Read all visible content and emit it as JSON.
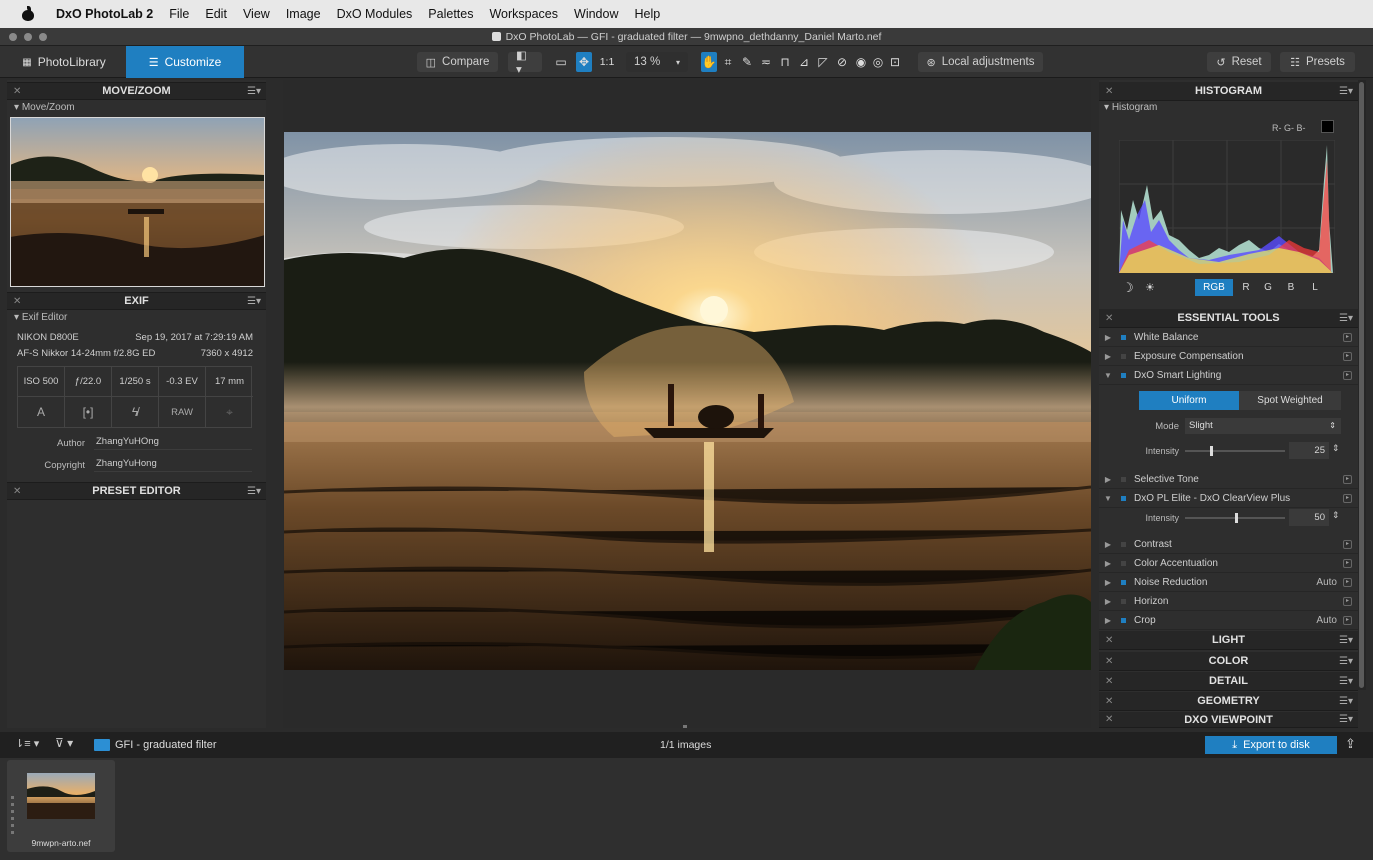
{
  "menubar": {
    "app_name": "DxO PhotoLab 2",
    "items": [
      "File",
      "Edit",
      "View",
      "Image",
      "DxO Modules",
      "Palettes",
      "Workspaces",
      "Window",
      "Help"
    ]
  },
  "titlebar": {
    "title": "DxO PhotoLab — GFI - graduated filter — 9mwpno_dethdanny_Daniel Marto.nef"
  },
  "toolbar": {
    "tab_library": "PhotoLibrary",
    "tab_customize": "Customize",
    "compare_label": "Compare",
    "one_to_one": "1:1",
    "zoom_value": "13 %",
    "local_adjustments_label": "Local adjustments",
    "reset_label": "Reset",
    "presets_label": "Presets"
  },
  "left": {
    "movezoom_title": "MOVE/ZOOM",
    "movezoom_sub": "Move/Zoom",
    "exif_title": "EXIF",
    "exif_sub": "Exif Editor",
    "camera": "NIKON D800E",
    "date": "Sep 19, 2017 at 7:29:19 AM",
    "lens": "AF-S Nikkor 14-24mm f/2.8G ED",
    "dimensions": "7360 x 4912",
    "iso": "ISO 500",
    "aperture": "ƒ/22.0",
    "shutter": "1/250 s",
    "ev": "-0.3 EV",
    "focal": "17 mm",
    "mode_a": "A",
    "raw": "RAW",
    "author_label": "Author",
    "author_value": "ZhangYuHOng",
    "copyright_label": "Copyright",
    "copyright_value": "ZhangYuHong",
    "preset_editor_title": "PRESET EDITOR"
  },
  "right": {
    "histogram_title": "HISTOGRAM",
    "histogram_sub": "Histogram",
    "rgb_readout": "R- G- B-",
    "channels": [
      "RGB",
      "R",
      "G",
      "B",
      "L"
    ],
    "essential_title": "ESSENTIAL TOOLS",
    "tools": [
      {
        "label": "White Balance",
        "auto": ""
      },
      {
        "label": "Exposure Compensation",
        "auto": ""
      },
      {
        "label": "DxO Smart Lighting",
        "auto": ""
      }
    ],
    "smart_lighting": {
      "uniform_label": "Uniform",
      "spot_label": "Spot Weighted",
      "mode_label": "Mode",
      "mode_value": "Slight",
      "intensity_label": "Intensity",
      "intensity_value": "25",
      "intensity_level": 0.25
    },
    "selective_tone": "Selective Tone",
    "clearview": {
      "label": "DxO PL Elite - DxO ClearView Plus",
      "intensity_label": "Intensity",
      "intensity_value": "50",
      "intensity_level": 0.5
    },
    "tools2": [
      {
        "label": "Contrast",
        "auto": ""
      },
      {
        "label": "Color Accentuation",
        "auto": ""
      },
      {
        "label": "Noise Reduction",
        "auto": "Auto"
      },
      {
        "label": "Horizon",
        "auto": ""
      },
      {
        "label": "Crop",
        "auto": "Auto"
      }
    ],
    "sections": [
      "LIGHT",
      "COLOR",
      "DETAIL",
      "GEOMETRY",
      "DXO VIEWPOINT"
    ]
  },
  "bottom": {
    "folder_name": "GFI - graduated filter",
    "count": "1/1 images",
    "export_label": "Export to disk",
    "thumb_caption": "9mwpn-arto.nef"
  },
  "colors": {
    "accent": "#1f7fc1"
  }
}
